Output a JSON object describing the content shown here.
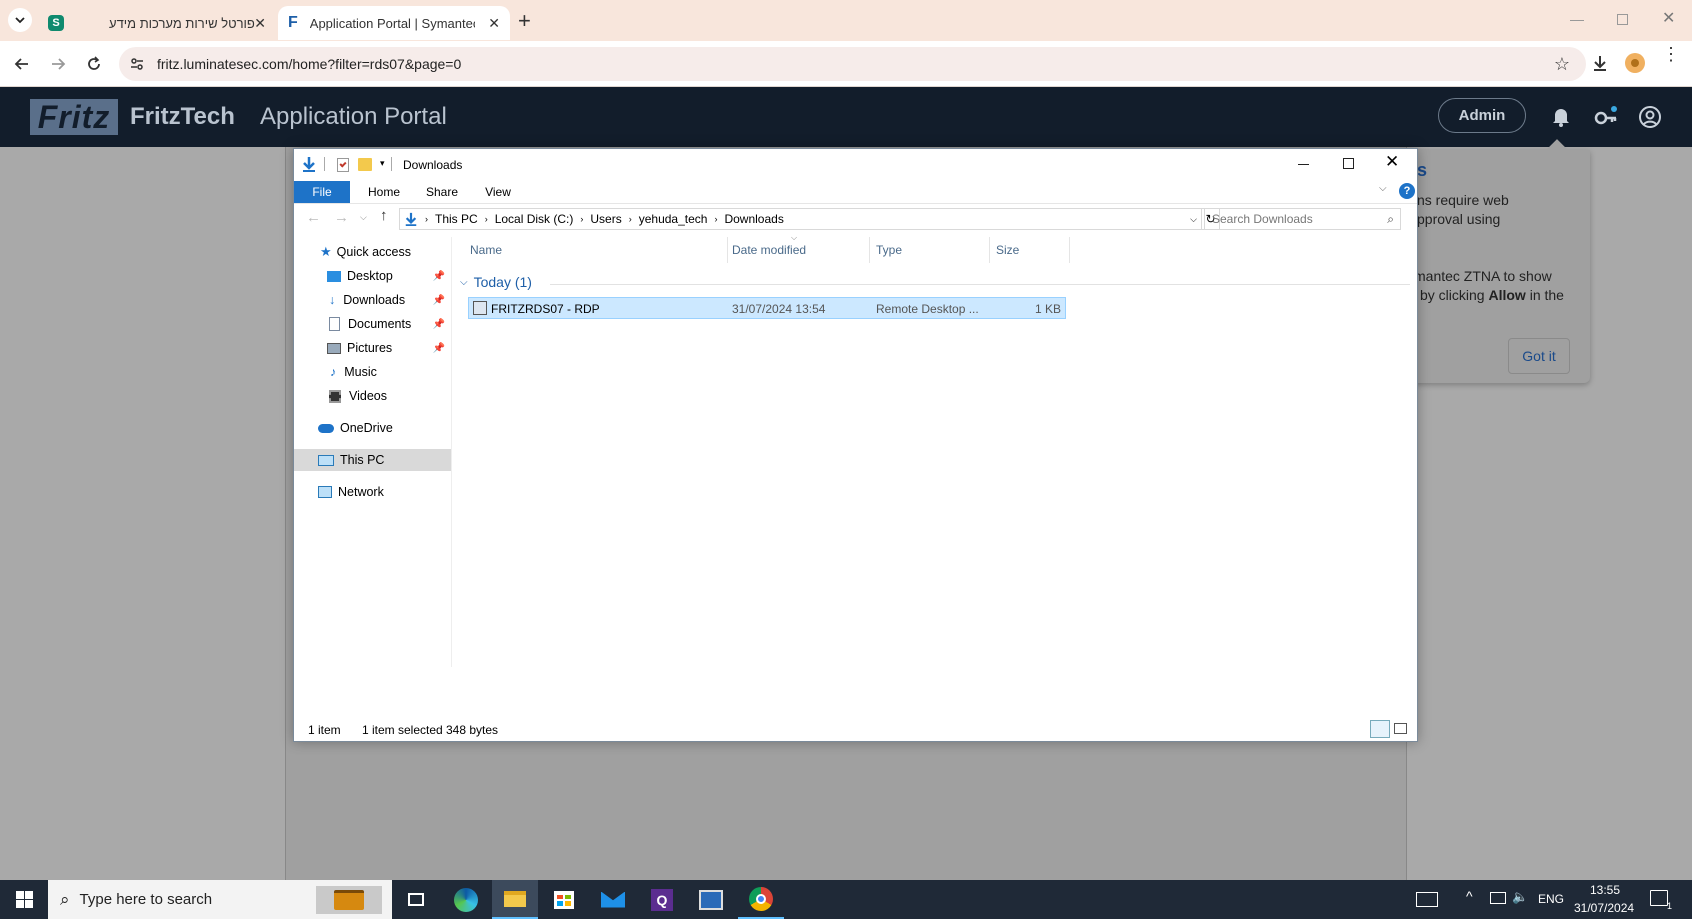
{
  "browser": {
    "tabs": [
      {
        "title": "פורטל שירות מערכות מידע",
        "active": false,
        "favicon": "s-icon"
      },
      {
        "title": "Application Portal | Symantec Z",
        "active": true,
        "favicon": "fritz-f-icon"
      }
    ],
    "url": "fritz.luminatesec.com/home?filter=rds07&page=0"
  },
  "portal": {
    "logo_text": "Fritz",
    "brand": "FritzTech",
    "title": "Application Portal",
    "admin_label": "Admin",
    "popover": {
      "heading_fragment": "s",
      "line1": "ns require web",
      "line2": "pproval using",
      "line3": "mantec ZTNA to show",
      "line4_pre": "by clicking ",
      "line4_bold": "Allow",
      "line4_post": " in the",
      "got_it": "Got it"
    }
  },
  "explorer": {
    "title": "Downloads",
    "ribbon_tabs": [
      "File",
      "Home",
      "Share",
      "View"
    ],
    "breadcrumb": [
      "This PC",
      "Local Disk (C:)",
      "Users",
      "yehuda_tech",
      "Downloads"
    ],
    "search_placeholder": "Search Downloads",
    "nav": {
      "quick_access": "Quick access",
      "desktop": "Desktop",
      "downloads": "Downloads",
      "documents": "Documents",
      "pictures": "Pictures",
      "music": "Music",
      "videos": "Videos",
      "onedrive": "OneDrive",
      "this_pc": "This PC",
      "network": "Network"
    },
    "columns": {
      "name": "Name",
      "date": "Date modified",
      "type": "Type",
      "size": "Size"
    },
    "group": "Today (1)",
    "files": [
      {
        "name": "FRITZRDS07 - RDP",
        "date": "31/07/2024 13:54",
        "type": "Remote Desktop ...",
        "size": "1 KB",
        "selected": true
      }
    ],
    "status": {
      "count": "1 item",
      "selected": "1 item selected",
      "bytes": "348 bytes"
    }
  },
  "taskbar": {
    "search_placeholder": "Type here to search",
    "lang": "ENG",
    "time": "13:55",
    "date": "31/07/2024",
    "notifications": "1"
  },
  "colors": {
    "chrome_bg": "#f8e6dc",
    "portal_header": "#121d2b",
    "accent_blue": "#1e73c8",
    "selection": "#cce8ff"
  }
}
